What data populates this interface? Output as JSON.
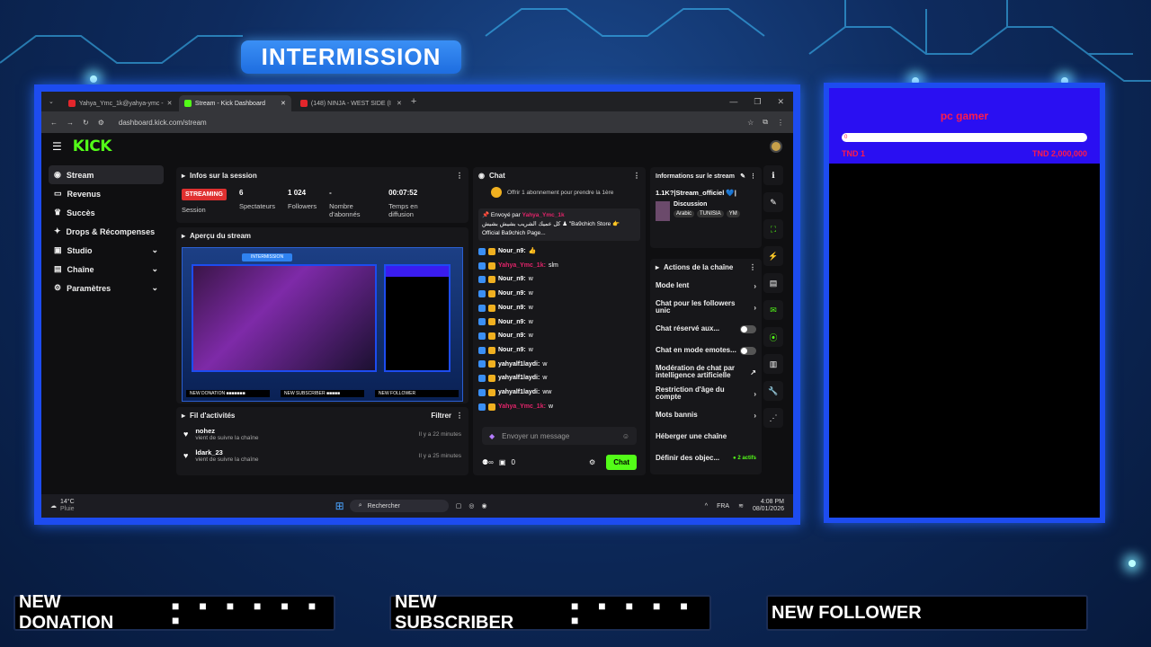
{
  "overlay": {
    "banner": "INTERMISSION",
    "alerts": {
      "donation": "NEW DONATION",
      "donation_dots": "■ ■ ■ ■ ■ ■ ■",
      "subscriber": "NEW SUBSCRIBER",
      "subscriber_dots": "■ ■ ■ ■ ■ ■",
      "follower": "NEW FOLLOWER"
    },
    "goal": {
      "title": "pc gamer",
      "bar_value": "0",
      "left": "TND 1",
      "right": "TND 2,000,000",
      "progress": 0
    }
  },
  "browser": {
    "tabs": [
      {
        "label": "Yahya_Ymc_1k@yahya-ymc -",
        "color": "#e3262c"
      },
      {
        "label": "Stream - Kick Dashboard",
        "color": "#53fc18"
      },
      {
        "label": "(148) NINJA - WEST SIDE (I",
        "color": "#e3262c"
      }
    ],
    "url": "dashboard.kick.com/stream"
  },
  "kick": {
    "logo": "KICK",
    "sidebar": [
      {
        "label": "Stream",
        "icon": "stream-icon"
      },
      {
        "label": "Revenus",
        "icon": "revenue-icon"
      },
      {
        "label": "Succès",
        "icon": "trophy-icon"
      },
      {
        "label": "Drops & Récompenses",
        "icon": "gift-icon"
      },
      {
        "label": "Studio",
        "icon": "studio-icon"
      },
      {
        "label": "Chaîne",
        "icon": "channel-icon"
      },
      {
        "label": "Paramètres",
        "icon": "gear-icon"
      }
    ],
    "session": {
      "title": "Infos sur la session",
      "status": "STREAMING",
      "status_label": "Session",
      "viewers": "6",
      "viewers_label": "Spectateurs",
      "followers": "1 024",
      "followers_label": "Followers",
      "subs": "-",
      "subs_label": "Nombre d'abonnés",
      "time": "00:07:52",
      "time_label": "Temps en diffusion"
    },
    "preview": {
      "title": "Aperçu du stream",
      "banner": "INTERMISSION",
      "labels": [
        "NEW DONATION ■■■■■■■",
        "NEW SUBSCRIBER ■■■■■",
        "NEW FOLLOWER"
      ]
    },
    "activity": {
      "title": "Fil d'activités",
      "filter": "Filtrer",
      "items": [
        {
          "user": "nohez",
          "text": "vient de suivre la chaîne",
          "time": "Il y a 22 minutes"
        },
        {
          "user": "ldark_23",
          "text": "vient de suivre la chaîne",
          "time": "Il y a 25 minutes"
        }
      ]
    },
    "chat": {
      "title": "Chat",
      "promo": "Offrir 1 abonnement pour prendre la 1ère",
      "pinned_by": "Envoyé par",
      "pinned_user": "Yahya_Ymc_1k",
      "pinned_text": "كل عميك الشريب بشيش بشيش ♟ \"Ba9chich Store 👉 Official Ba9chich Page...",
      "messages": [
        {
          "user": "Nour_n9:",
          "text": "👍",
          "red": false
        },
        {
          "user": "Yahya_Ymc_1k:",
          "text": "slm",
          "red": true
        },
        {
          "user": "Nour_n9:",
          "text": "w",
          "red": false
        },
        {
          "user": "Nour_n9:",
          "text": "w",
          "red": false
        },
        {
          "user": "Nour_n9:",
          "text": "w",
          "red": false
        },
        {
          "user": "Nour_n9:",
          "text": "w",
          "red": false
        },
        {
          "user": "Nour_n9:",
          "text": "w",
          "red": false
        },
        {
          "user": "Nour_n9:",
          "text": "w",
          "red": false
        },
        {
          "user": "yahyalf1laydi:",
          "text": "w",
          "red": false
        },
        {
          "user": "yahyalf1laydi:",
          "text": "w",
          "red": false
        },
        {
          "user": "yahyalf1laydi:",
          "text": "ww",
          "red": false
        },
        {
          "user": "Yahya_Ymc_1k:",
          "text": "w",
          "red": true
        }
      ],
      "placeholder": "Envoyer un message",
      "points": "0",
      "send": "Chat"
    },
    "info": {
      "title": "Informations sur le stream",
      "stream_title": "1.1K?|Stream_officiel 💙|",
      "category": "Discussion",
      "tags": [
        "Arabic",
        "TUNISIA",
        "YM"
      ]
    },
    "actions": {
      "title": "Actions de la chaîne",
      "items": [
        {
          "label": "Mode lent",
          "type": "chevron"
        },
        {
          "label": "Chat pour les followers unic",
          "type": "chevron"
        },
        {
          "label": "Chat réservé aux...",
          "type": "toggle"
        },
        {
          "label": "Chat en mode emotes...",
          "type": "toggle"
        },
        {
          "label": "Modération de chat par intelligence artificielle",
          "type": "external"
        },
        {
          "label": "Restriction d'âge du compte",
          "type": "chevron"
        },
        {
          "label": "Mots bannis",
          "type": "chevron"
        },
        {
          "label": "Héberger une chaîne",
          "type": "none"
        },
        {
          "label": "Définir des objec...",
          "type": "goal",
          "extra": "● 2 actifs"
        }
      ]
    }
  },
  "taskbar": {
    "weather": "14°C",
    "weather_sub": "Pluie",
    "search": "Rechercher",
    "lang": "FRA",
    "time": "4:08 PM",
    "date": "08/01/2026"
  }
}
